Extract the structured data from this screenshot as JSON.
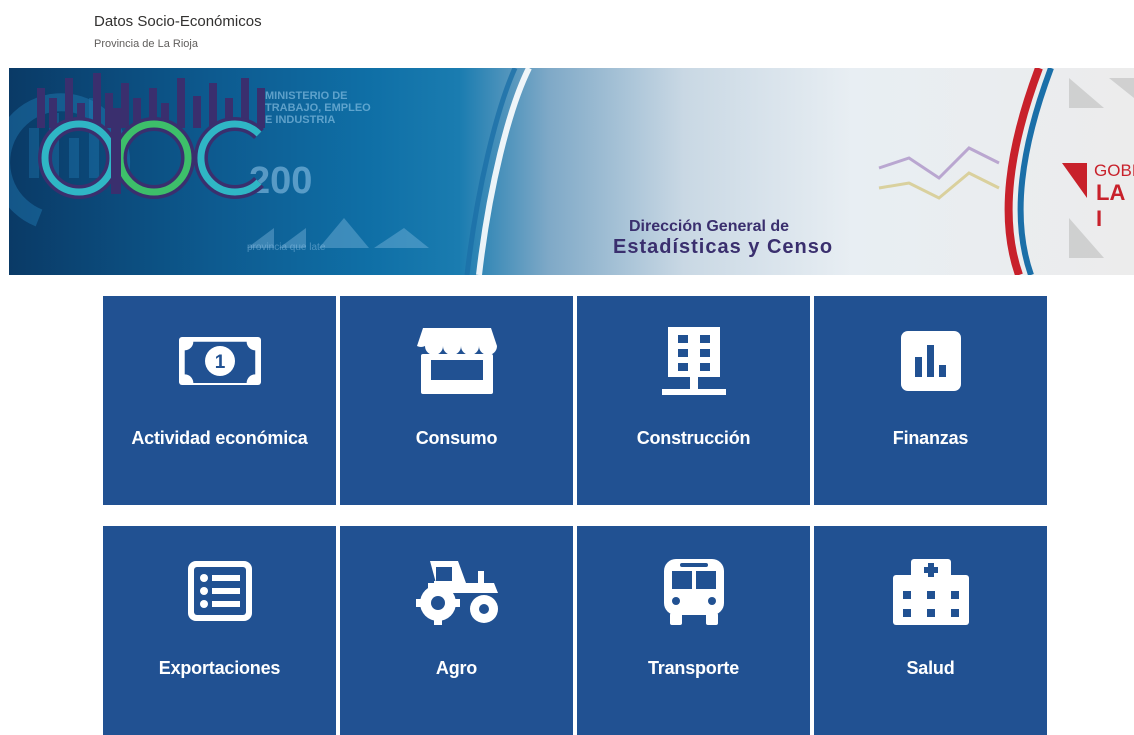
{
  "header": {
    "title": "Datos Socio-Económicos",
    "subtitle": "Provincia de La Rioja"
  },
  "banner": {
    "ministerio": [
      "MINISTERIO DE",
      "TRABAJO, EMPLEO",
      "E INDUSTRIA"
    ],
    "anniversary": "200",
    "provincia": "provincia que late",
    "dec_line1": "Dirección General de",
    "dec_line2": "Estadísticas y Censo",
    "gob_line1": "GOBI",
    "gob_line2": "LA I"
  },
  "tiles": [
    {
      "label": "Actividad económica",
      "icon": "money-icon"
    },
    {
      "label": "Consumo",
      "icon": "store-icon"
    },
    {
      "label": "Construcción",
      "icon": "building-icon"
    },
    {
      "label": "Finanzas",
      "icon": "bar-chart-icon"
    },
    {
      "label": "Exportaciones",
      "icon": "list-icon"
    },
    {
      "label": "Agro",
      "icon": "tractor-icon"
    },
    {
      "label": "Transporte",
      "icon": "bus-icon"
    },
    {
      "label": "Salud",
      "icon": "hospital-icon"
    }
  ],
  "colors": {
    "tile": "#215192",
    "tile_text": "#ffffff"
  }
}
